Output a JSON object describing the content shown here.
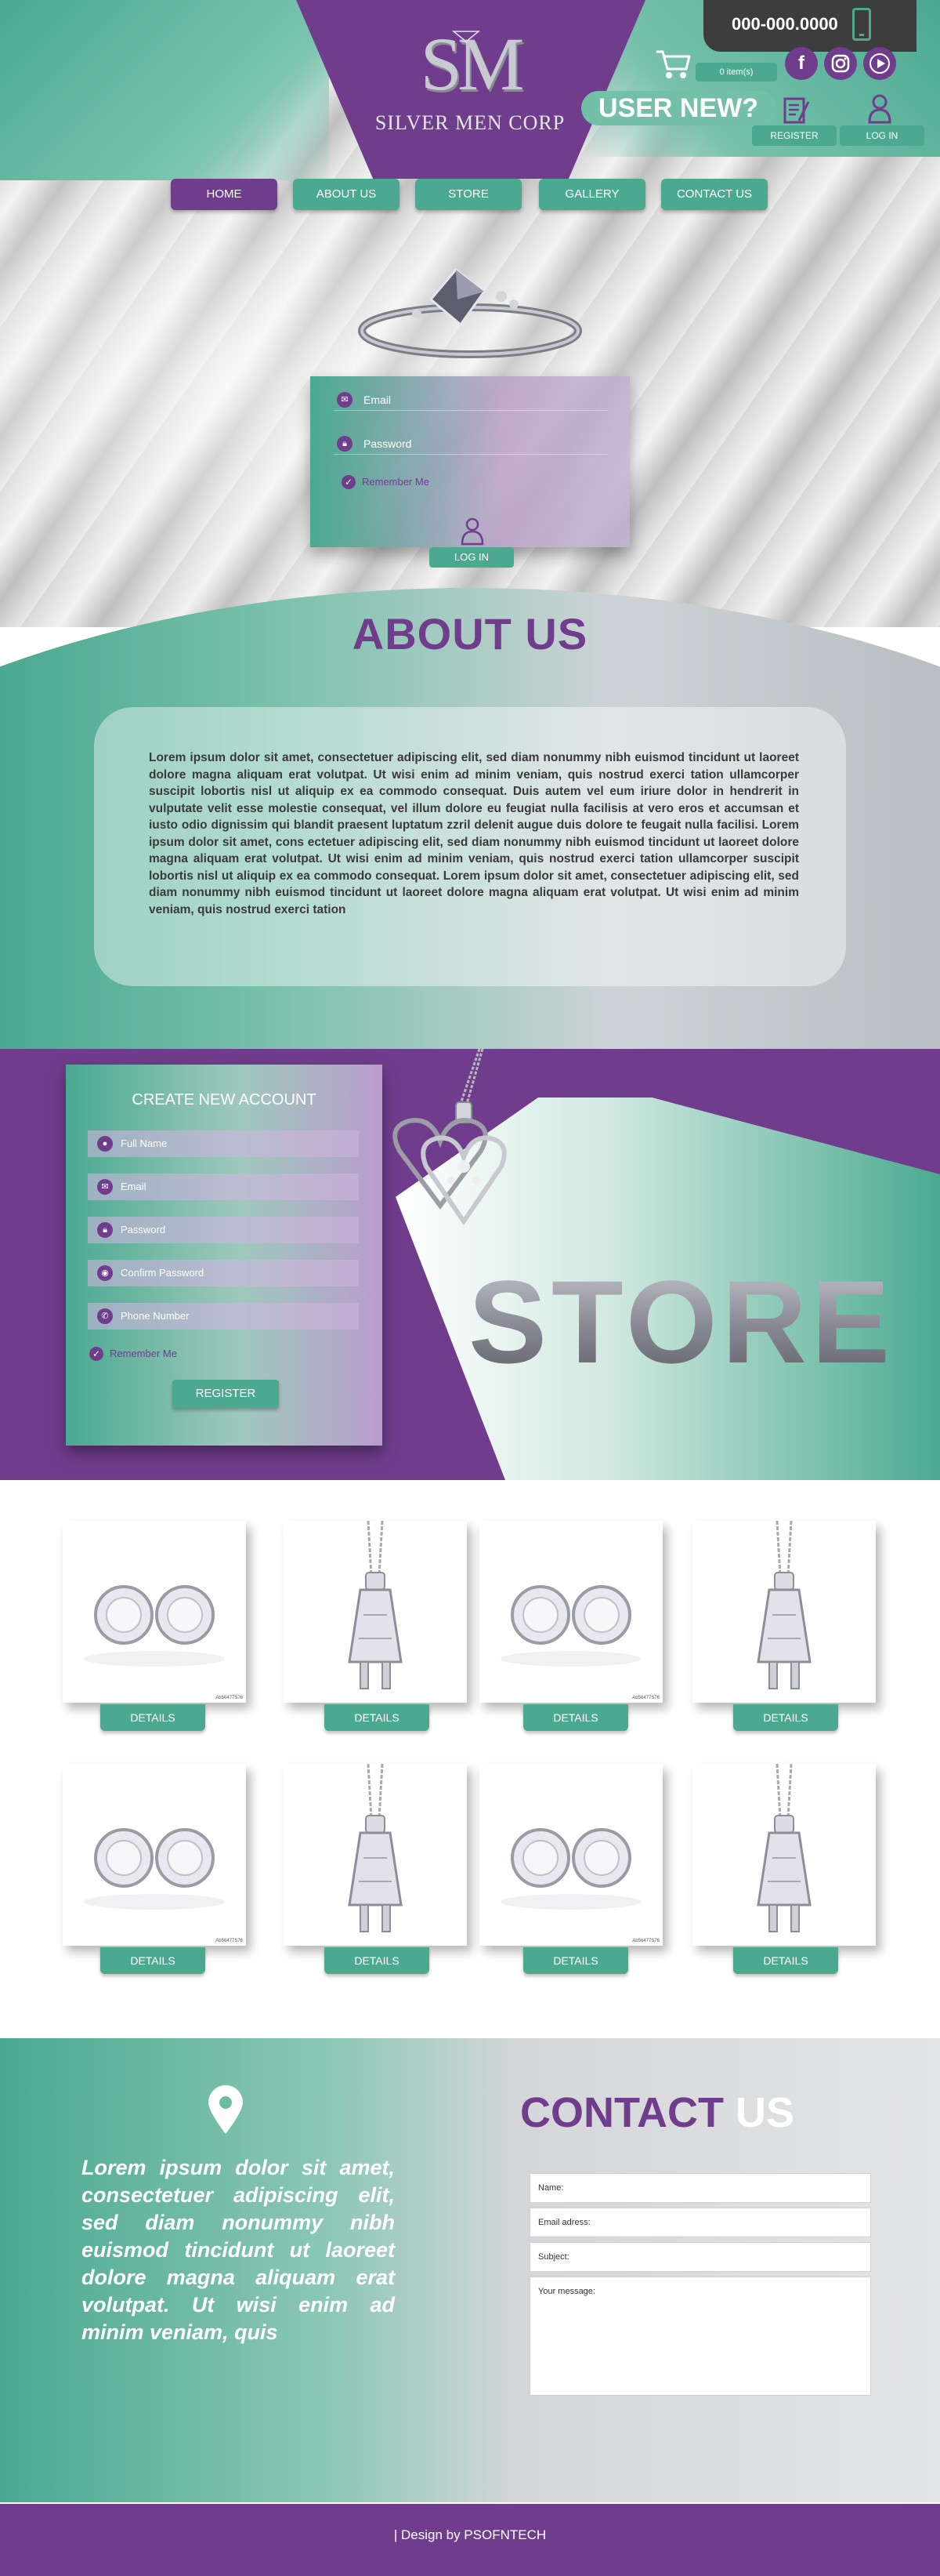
{
  "brand": {
    "monogram": "SM",
    "name": "SILVER MEN CORP"
  },
  "header": {
    "phone": "000-000.0000",
    "cart_count": "0 item(s)",
    "user_new": "USER NEW?",
    "register_label": "REGISTER",
    "login_label": "LOG IN",
    "social": [
      "facebook-icon",
      "instagram-icon",
      "youtube-icon"
    ]
  },
  "nav": {
    "items": [
      {
        "label": "HOME",
        "active": true
      },
      {
        "label": "ABOUT US",
        "active": false
      },
      {
        "label": "STORE",
        "active": false
      },
      {
        "label": "GALLERY",
        "active": false
      },
      {
        "label": "CONTACT US",
        "active": false
      }
    ]
  },
  "login": {
    "email_placeholder": "Email",
    "password_placeholder": "Password",
    "remember_label": "Remember Me",
    "button_label": "LOG IN"
  },
  "about": {
    "title": "ABOUT US",
    "text": "Lorem ipsum dolor sit amet, consectetuer adipiscing elit, sed diam nonummy nibh euismod tincidunt ut laoreet dolore magna aliquam erat volutpat. Ut wisi enim ad minim veniam, quis nostrud exerci tation ullamcorper suscipit lobortis nisl ut aliquip ex ea commodo consequat. Duis autem vel eum iriure dolor in hendrerit in vulputate velit esse molestie consequat, vel illum dolore eu feugiat nulla facilisis at vero eros et accumsan et iusto odio dignissim qui blandit praesent luptatum zzril delenit augue duis dolore te feugait nulla facilisi. Lorem ipsum dolor sit amet, cons ectetuer adipiscing elit, sed diam nonummy nibh euismod tincidunt ut laoreet dolore magna aliquam erat volutpat. Ut wisi enim ad minim veniam, quis nostrud exerci tation ullamcorper suscipit lobortis nisl ut aliquip ex ea commodo consequat. Lorem ipsum dolor sit amet, consectetuer adipiscing elit, sed diam nonummy nibh euismod tincidunt ut laoreet dolore magna aliquam erat volutpat. Ut wisi enim ad minim veniam, quis nostrud exerci tation"
  },
  "signup": {
    "title": "CREATE NEW ACCOUNT",
    "fields": [
      {
        "placeholder": "Full Name",
        "icon": "user-icon"
      },
      {
        "placeholder": "Email",
        "icon": "mail-icon"
      },
      {
        "placeholder": "Password",
        "icon": "lock-icon"
      },
      {
        "placeholder": "Confirm Password",
        "icon": "eye-icon"
      },
      {
        "placeholder": "Phone Number",
        "icon": "phone-icon"
      }
    ],
    "remember_label": "Remember Me",
    "button_label": "REGISTER"
  },
  "store": {
    "word": "STORE"
  },
  "products": {
    "items": [
      {
        "type": "earrings",
        "code": "Ab56477S76",
        "button": "DETAILS"
      },
      {
        "type": "pendant",
        "code": "",
        "button": "DETAILS"
      },
      {
        "type": "earrings",
        "code": "Ab56477S76",
        "button": "DETAILS"
      },
      {
        "type": "pendant",
        "code": "",
        "button": "DETAILS"
      },
      {
        "type": "earrings",
        "code": "Ab56477S76",
        "button": "DETAILS"
      },
      {
        "type": "pendant",
        "code": "",
        "button": "DETAILS"
      },
      {
        "type": "earrings",
        "code": "Ab56477S76",
        "button": "DETAILS"
      },
      {
        "type": "pendant",
        "code": "",
        "button": "DETAILS"
      }
    ]
  },
  "contact": {
    "title_part1": "CONTACT",
    "title_part2": "US",
    "text": "Lorem ipsum dolor sit amet, consectetuer adipiscing elit, sed diam nonummy nibh euismod tincidunt ut laoreet dolore magna aliquam erat volutpat. Ut wisi enim ad minim veniam, quis",
    "fields": {
      "name": "Name:",
      "email": "Email adress:",
      "subject": "Subject:",
      "message": "Your message:"
    }
  },
  "footer": {
    "text": "| Design by PSOFNTECH"
  },
  "colors": {
    "purple": "#6f3d8c",
    "teal": "#4aa98f"
  }
}
